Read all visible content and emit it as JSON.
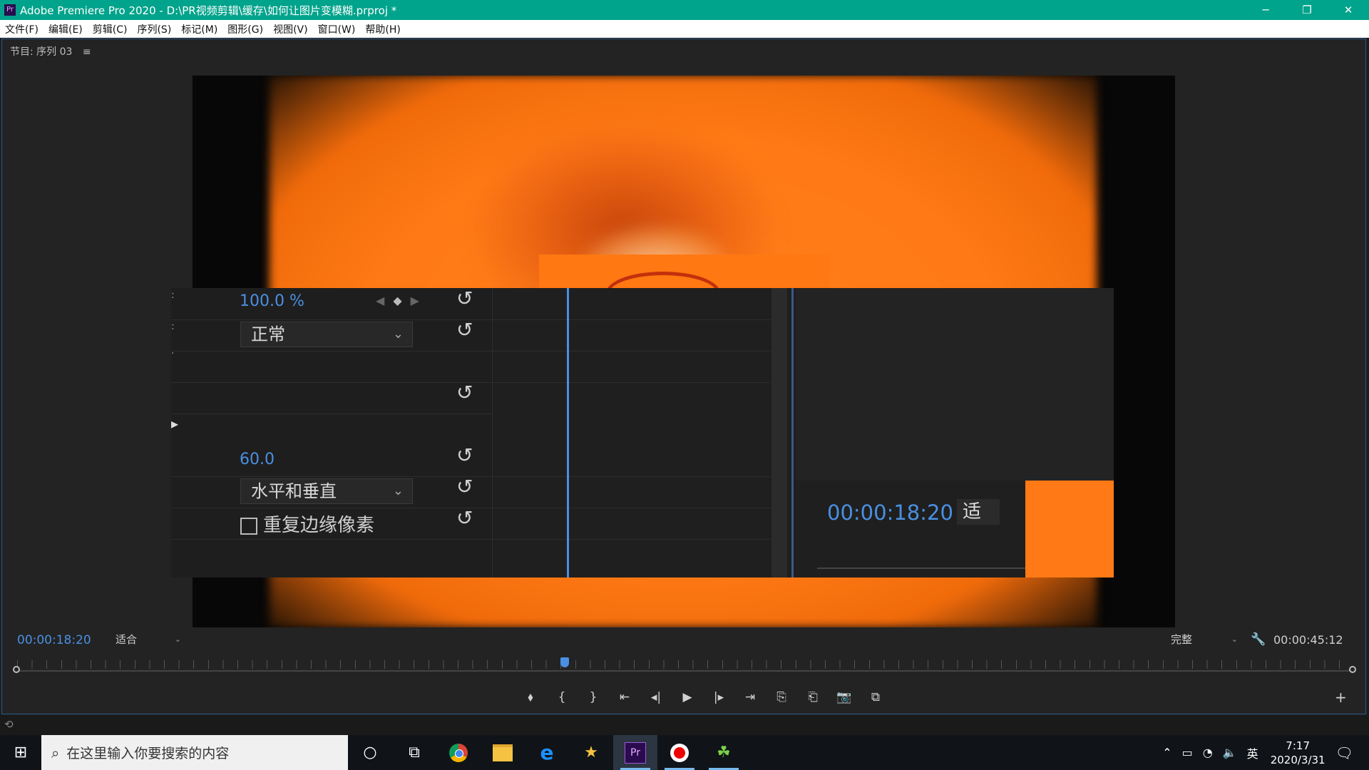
{
  "window": {
    "title": "Adobe Premiere Pro 2020 - D:\\PR视频剪辑\\缓存\\如何让图片变模糊.prproj *",
    "app_icon": "Pr",
    "controls": [
      "─",
      "❐",
      "✕"
    ]
  },
  "menu": [
    "文件(F)",
    "编辑(E)",
    "剪辑(C)",
    "序列(S)",
    "标记(M)",
    "图形(G)",
    "视图(V)",
    "窗口(W)",
    "帮助(H)"
  ],
  "panel": {
    "tab_label": "节目: 序列 03",
    "tab_menu_glyph": "≡"
  },
  "effect_controls": {
    "opacity_value": "100.0 %",
    "blend_mode": "正常",
    "blur_amount": "60.0",
    "blur_dimensions": "水平和垂直",
    "repeat_edge_label": "重复边缘像素",
    "reset_glyph": "↺",
    "timecode": "00:00:18:20",
    "fit_partial": "适"
  },
  "program_monitor": {
    "current_time": "00:00:18:20",
    "zoom_level": "适合",
    "quality": "完整",
    "duration": "00:00:45:12",
    "playhead_fraction": 0.41
  },
  "transport_glyphs": [
    "⬧",
    "{",
    "}",
    "⇤",
    "◂|",
    "▶",
    "|▸",
    "⇥",
    "⎘",
    "⎗",
    "📷",
    "⧉"
  ],
  "add_glyph": "+",
  "taskbar": {
    "start_glyph": "⊞",
    "search_placeholder": "在这里输入你要搜索的内容",
    "cortana_glyph": "○",
    "taskview_glyph": "⧉",
    "apps": [
      "chrome",
      "file-explorer",
      "edge",
      "favorites",
      "premiere-pro",
      "recorder",
      "clover"
    ],
    "tray_language": "英",
    "clock_time": "7:17",
    "clock_date": "2020/3/31"
  }
}
